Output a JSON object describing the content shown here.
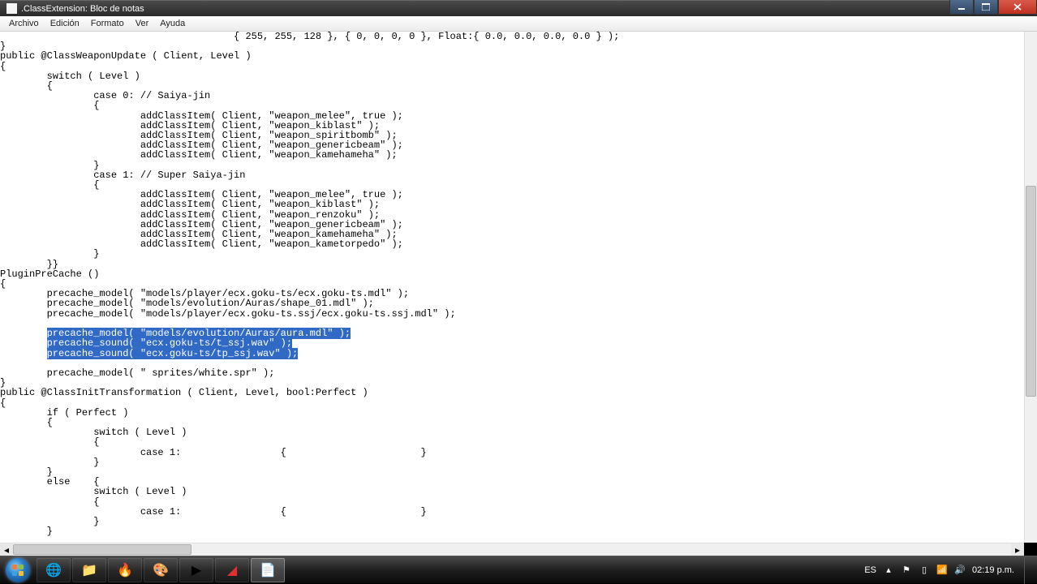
{
  "window": {
    "title": ".ClassExtension: Bloc de notas"
  },
  "menu": {
    "items": [
      "Archivo",
      "Edición",
      "Formato",
      "Ver",
      "Ayuda"
    ]
  },
  "code": {
    "l1": "                                        { 255, 255, 128 }, { 0, 0, 0, 0 }, Float:{ 0.0, 0.0, 0.0, 0.0 } );",
    "l2": "}",
    "l3": "public @ClassWeaponUpdate ( Client, Level )",
    "l4": "{",
    "l5": "        switch ( Level )",
    "l6": "        {",
    "l7": "                case 0: // Saiya-jin",
    "l8": "                {",
    "l9": "                        addClassItem( Client, \"weapon_melee\", true );",
    "l10": "                        addClassItem( Client, \"weapon_kiblast\" );",
    "l11": "                        addClassItem( Client, \"weapon_spiritbomb\" );",
    "l12": "                        addClassItem( Client, \"weapon_genericbeam\" );",
    "l13": "                        addClassItem( Client, \"weapon_kamehameha\" );",
    "l14": "                }",
    "l15": "                case 1: // Super Saiya-jin",
    "l16": "                {",
    "l17": "                        addClassItem( Client, \"weapon_melee\", true );",
    "l18": "                        addClassItem( Client, \"weapon_kiblast\" );",
    "l19": "                        addClassItem( Client, \"weapon_renzoku\" );",
    "l20": "                        addClassItem( Client, \"weapon_genericbeam\" );",
    "l21": "                        addClassItem( Client, \"weapon_kamehameha\" );",
    "l22": "                        addClassItem( Client, \"weapon_kametorpedo\" );",
    "l23": "                }",
    "l24": "        }}",
    "l25": "PluginPreCache ()",
    "l26": "{",
    "l27": "        precache_model( \"models/player/ecx.goku-ts/ecx.goku-ts.mdl\" );",
    "l28": "        precache_model( \"models/evolution/Auras/shape_01.mdl\" );",
    "l29": "        precache_model( \"models/player/ecx.goku-ts.ssj/ecx.goku-ts.ssj.mdl\" );",
    "l30": "",
    "l31pre": "        ",
    "l31sel": "precache_model( \"models/evolution/Auras/aura.mdl\" );",
    "l32pre": "        ",
    "l32sel": "precache_sound( \"ecx.goku-ts/t_ssj.wav\" );",
    "l33pre": "        ",
    "l33sel": "precache_sound( \"ecx.goku-ts/tp_ssj.wav\" );",
    "l34": "",
    "l35": "        precache_model( \" sprites/white.spr\" );",
    "l36": "}",
    "l37": "public @ClassInitTransformation ( Client, Level, bool:Perfect )",
    "l38": "{",
    "l39": "        if ( Perfect )",
    "l40": "        {",
    "l41": "                switch ( Level )",
    "l42": "                {",
    "l43": "                        case 1:                 {                       }",
    "l44": "                }",
    "l45": "        }",
    "l46": "        else    {",
    "l47": "                switch ( Level )",
    "l48": "                {",
    "l49": "                        case 1:                 {                       }",
    "l50": "                }",
    "l51": "        }"
  },
  "tray": {
    "lang": "ES",
    "time": "02:19 p.m."
  }
}
